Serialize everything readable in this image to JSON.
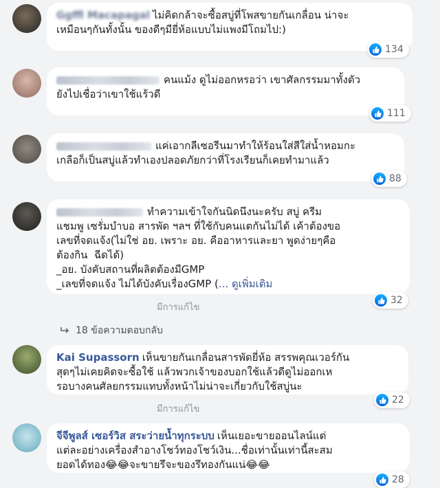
{
  "comments": [
    {
      "author": "Ggffl Macapagal",
      "text": "ไม่คิดกล้าจะซื้อสบู่ที่โพสขายกันเกลื่อน น่าจะ\nเหมือนๆกันทั้งนั้น ของดีๆมียี่ห้อแบบไม่แพงมีโถมไป:)",
      "likes": "134"
    },
    {
      "author": "",
      "text": "คนแม้ง ดูไม่ออกหรอว่า เขาศัลกรรมมาทั้งตัว\nยังไปเชื่อว่าเขาใช้แร้วดี",
      "likes": "111"
    },
    {
      "author": "",
      "text": "แค่เอากลีเซอรีนมาทำให้ร้อนใส่สีใส่น้ำหอมกะ\nเกลือก็เป็นสบู่แล้วทำเองปลอดภัยกว่าที่โรงเรียนก็เคยทำมาแล้ว",
      "likes": "88"
    },
    {
      "author": "",
      "text": "ทำความเข้าใจกันนิดนึงนะครับ สบู่ ครีม\nแชมพู เซรั่มบำบอ สารพัด ฯลฯ ที่ใช้กับคนแตกันไม่ได้ เค้าต้องขอ\nเลขที่จดแจ้ง(ไม่ใช่ อย. เพราะ อย. คืออาหารและยา พูดง่ายๆคือ\nต้องกิน  ฉีดได้)\n_อย. บังคับสถานที่ผลิตต้องมีGMP\n_เลขที่จดแจ้ง ไม่ได้บังคับเรื่องGMP (",
      "see_more": "... ดูเพิ่มเติม",
      "edited": "มีการแก้ไข",
      "likes": "32",
      "replies": "18 ข้อความตอบกลับ"
    },
    {
      "author": "Kai Supassorn",
      "text": "เห็นขายกันเกลื่อนสารพัดยี่ห้อ สรรพคุณเวอร์กัน\nสุดๆไม่เคยคิดจะซื้อใช้ แล้วพวกเจ้าของบอกใช้แล้วดีดูไม่ออกเห\nรอบางคนศัลยกรรมแทบทั้งหน้าไม่น่าจะเกี่ยวกับใช้สบู่นะ",
      "edited": "มีการแก้ไข",
      "likes": "22"
    },
    {
      "author": "จีจีพูลส์ เซอร์วิส สระว่ายน้ำทุกระบบ",
      "text": "เห็นเยอะขายออนไลน์แต่\nแต่ละอย่างเครื่องสำอางโชว์ทองโชว์เงิน...ชื่อเท่านั้นเท่านี้สะสม\nยอดได้ทอง😂😂จะขายรึจะของรึทองกันแน่😂😂",
      "likes": "28"
    }
  ],
  "colors": {
    "link": "#385898",
    "bubble": "#ffffff",
    "background": "#f2f3f5",
    "like": "#1877f2"
  },
  "icons": {
    "like": "thumbs-up-icon",
    "reply": "reply-arrow-icon"
  }
}
